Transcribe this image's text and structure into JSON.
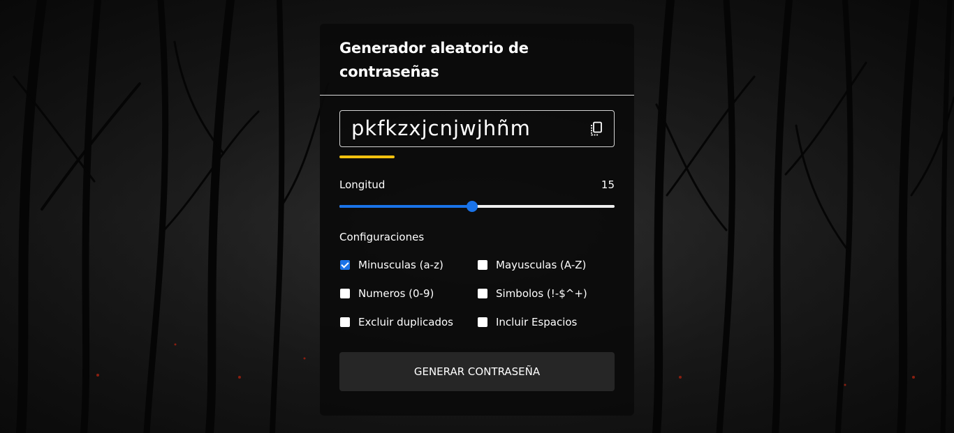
{
  "card": {
    "title": "Generador aleatorio de contraseñas"
  },
  "password": {
    "value": "pkfkzxjcnjwjhñm",
    "copy_icon": "copy-icon",
    "strength_level": 0.2,
    "strength_color": "#f2c10f"
  },
  "length": {
    "label": "Longitud",
    "value": "15",
    "min": 1,
    "max": 30,
    "accent_color": "#1a73e8"
  },
  "settings": {
    "label": "Configuraciones",
    "options": [
      {
        "label": "Minusculas (a-z)",
        "checked": true
      },
      {
        "label": "Mayusculas (A-Z)",
        "checked": false
      },
      {
        "label": "Numeros (0-9)",
        "checked": false
      },
      {
        "label": "Simbolos (!-$^+)",
        "checked": false
      },
      {
        "label": "Excluir duplicados",
        "checked": false
      },
      {
        "label": "Incluir Espacios",
        "checked": false
      }
    ]
  },
  "generate_button": {
    "label": "GENERAR CONTRASEÑA"
  }
}
